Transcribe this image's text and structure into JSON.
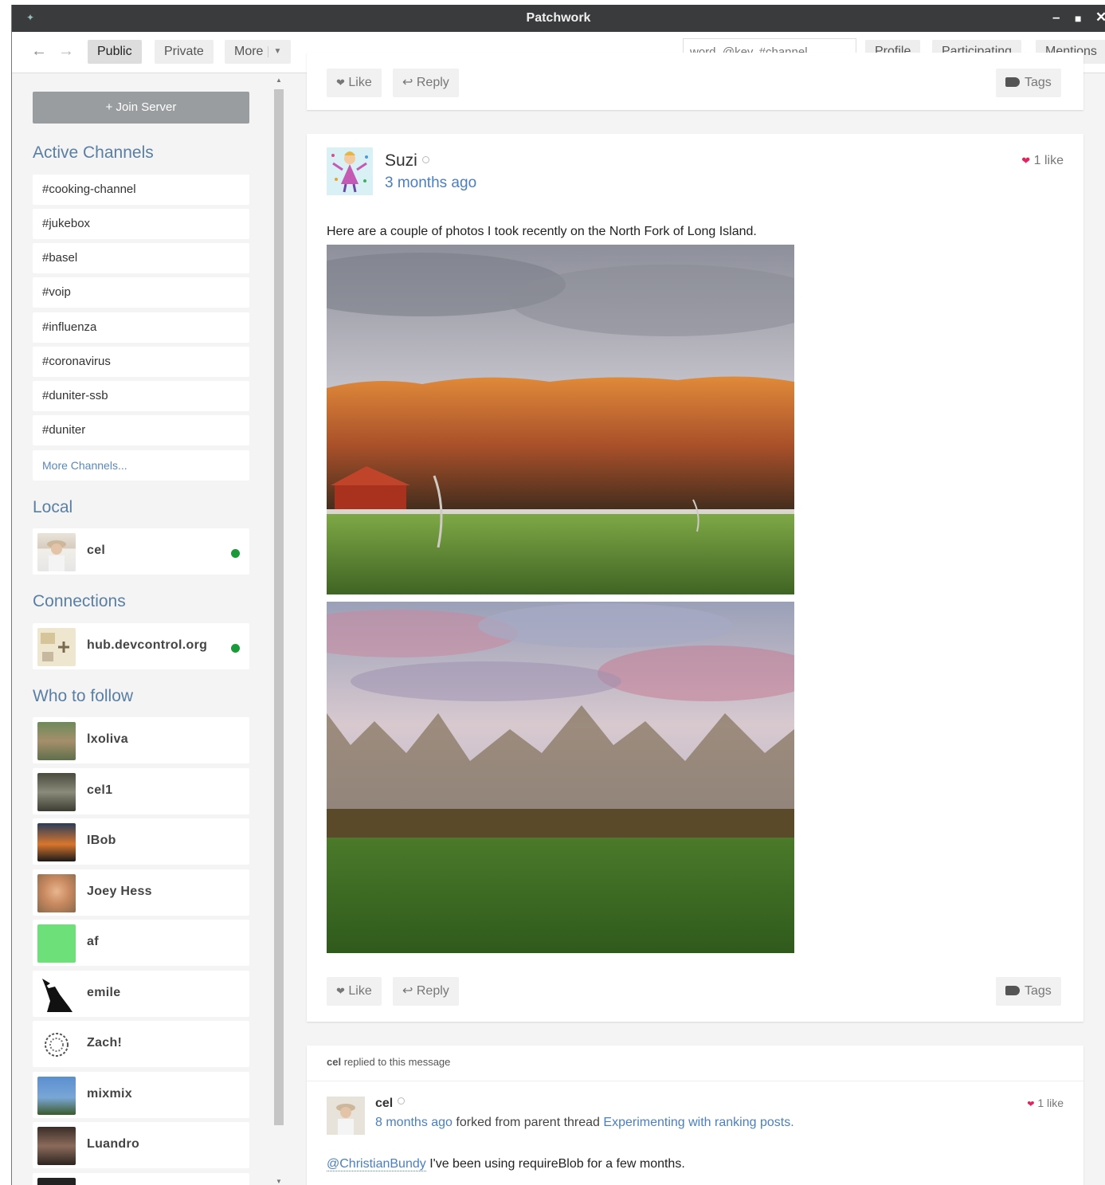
{
  "window": {
    "title": "Patchwork"
  },
  "toolbar": {
    "tabs": [
      "Public",
      "Private",
      "More"
    ],
    "search_placeholder": "word, @key, #channel",
    "right_buttons": [
      "Profile",
      "Participating",
      "Mentions"
    ]
  },
  "sidebar": {
    "join_button": "+ Join Server",
    "active_channels_title": "Active Channels",
    "channels": [
      "#cooking-channel",
      "#jukebox",
      "#basel",
      "#voip",
      "#influenza",
      "#coronavirus",
      "#duniter-ssb",
      "#duniter"
    ],
    "more_channels": "More Channels...",
    "local_title": "Local",
    "local": [
      {
        "name": "cel",
        "online": true
      }
    ],
    "connections_title": "Connections",
    "connections": [
      {
        "name": "hub.devcontrol.org",
        "online": true
      }
    ],
    "who_to_follow_title": "Who to follow",
    "who_to_follow": [
      {
        "name": "lxoliva"
      },
      {
        "name": "cel1"
      },
      {
        "name": "IBob"
      },
      {
        "name": "Joey Hess"
      },
      {
        "name": "af"
      },
      {
        "name": "emile"
      },
      {
        "name": "Zach!"
      },
      {
        "name": "mixmix"
      },
      {
        "name": "Luandro"
      }
    ]
  },
  "feed": {
    "prev_actions": {
      "like": "Like",
      "reply": "Reply",
      "tags": "Tags"
    },
    "post": {
      "author": "Suzi",
      "time": "3 months ago",
      "likes": "1 like",
      "text": "Here are a couple of photos I took recently on the North Fork of Long Island.",
      "like": "Like",
      "reply": "Reply",
      "tags": "Tags"
    },
    "reply_notice": {
      "author": "cel",
      "text": "replied to this message"
    },
    "reply": {
      "author": "cel",
      "time": "8 months ago",
      "forked_text": "forked from parent thread",
      "thread_link": "Experimenting with ranking posts.",
      "likes": "1 like",
      "mention": "@ChristianBundy",
      "text": "I've been using requireBlob for a few months."
    }
  },
  "colors": {
    "accent": "#5a7fa3",
    "link": "#4a7fc1",
    "heart": "#e0245e",
    "online": "#1b9a3a",
    "titlebar": "#3a3b3c"
  }
}
